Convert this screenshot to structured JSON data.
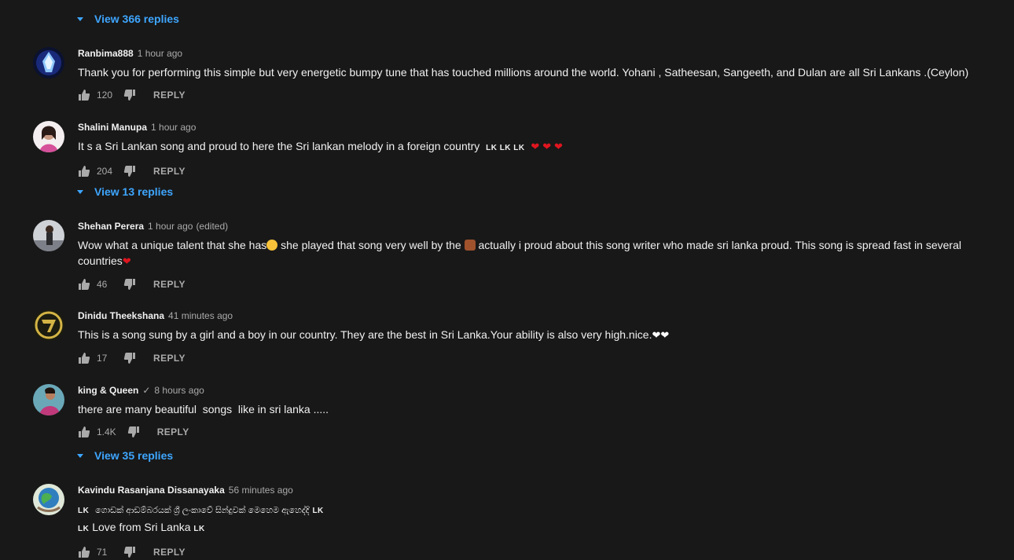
{
  "top_replies": "View 366 replies",
  "reply_label": "REPLY",
  "comments": [
    {
      "author": "Ranbima888",
      "time": "1 hour ago",
      "text": "Thank you for performing this simple but very energetic bumpy tune that has touched millions around the world. Yohani , Satheesan, Sangeeth, and Dulan are all Sri Lankans .(Ceylon)",
      "likes": "120"
    },
    {
      "author": "Shalini Manupa",
      "time": "1 hour ago",
      "text": "It s a Sri Lankan song and proud to here the Sri lankan melody in a foreign country",
      "lk_tags": "LK LK LK",
      "likes": "204",
      "replies": "View 13 replies"
    },
    {
      "author": "Shehan Perera",
      "time": "1 hour ago",
      "edited": "(edited)",
      "text_a": "Wow what a unique talent that she has",
      "text_b": " she played that song very well by the ",
      "text_c": " actually i proud about this song writer who made sri lanka proud. This song is spread fast in several countries",
      "likes": "46"
    },
    {
      "author": "Dinidu Theekshana",
      "time": "41 minutes ago",
      "text": "This is a song sung by a girl and a boy in our country. They are the best in Sri Lanka.Your ability is also very high.nice.",
      "likes": "17"
    },
    {
      "author": "king & Queen",
      "verified": "✓",
      "time": "8 hours ago",
      "text": "there are many beautiful  songs  like in sri lanka .....",
      "likes": "1.4K",
      "replies": "View 35 replies"
    },
    {
      "author": "Kavindu Rasanjana Dissanayaka",
      "time": "56 minutes ago",
      "lk": "LK",
      "text_line1": "ගොඩක් ආඩම්බරයක් ශ්‍රී ලංකාවේ සින්දුවක් මෙහෙම ඇහෙද්දි",
      "text_line2": "Love from Sri Lanka",
      "likes": "71"
    }
  ],
  "colors": {
    "background": "#181818",
    "text": "#f1f1f1",
    "muted": "#aaaaaa",
    "link": "#3ea6ff",
    "heart": "#e0151f"
  },
  "icons": [
    "thumb-up-icon",
    "thumb-down-icon",
    "caret-down-icon",
    "verified-check-icon"
  ]
}
